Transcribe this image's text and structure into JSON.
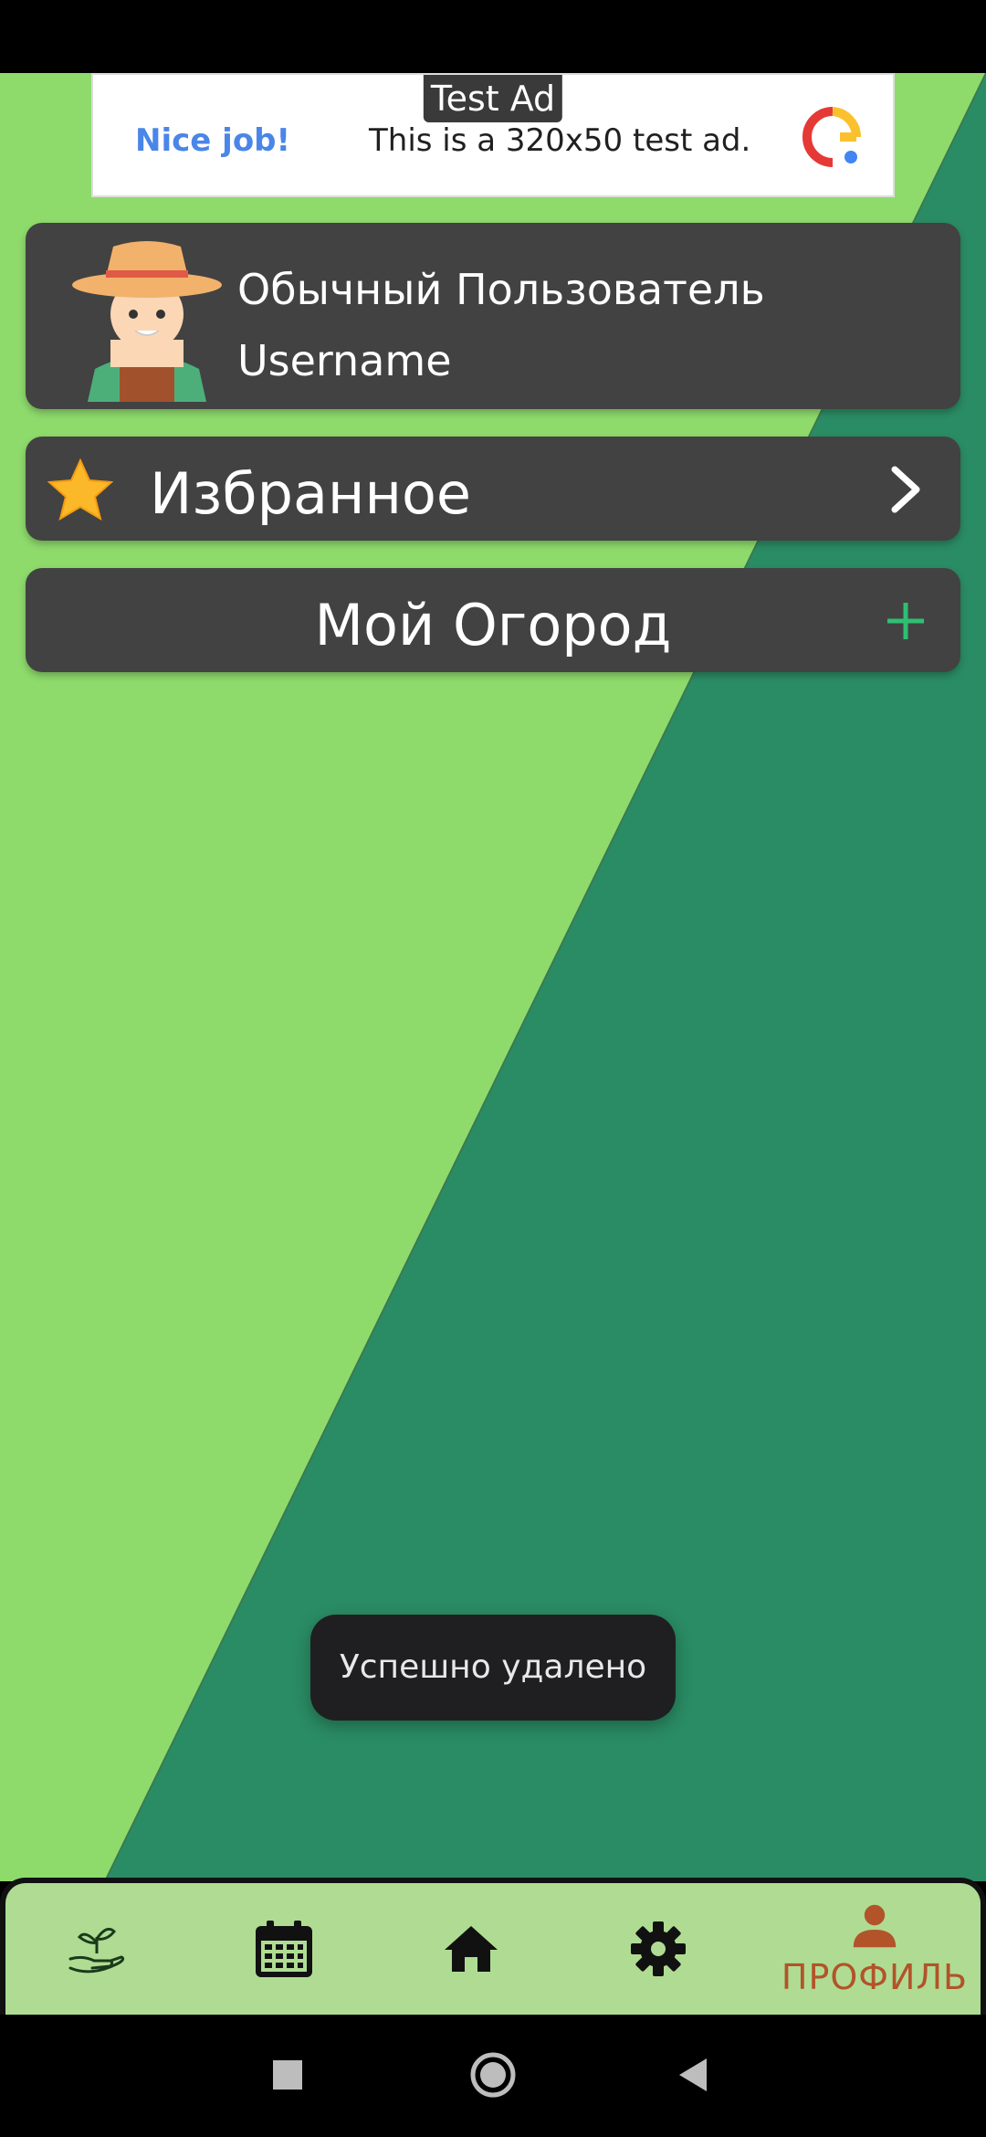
{
  "ad": {
    "label": "Test Ad",
    "headline": "Nice job!",
    "text": "This is a 320x50 test ad."
  },
  "profile": {
    "name": "Обычный Пользователь",
    "username": "Username"
  },
  "favorites": {
    "label": "Избранное"
  },
  "garden": {
    "label": "Мой Огород"
  },
  "toast": {
    "text": "Успешно удалено"
  },
  "bottom_nav": {
    "items": [
      {
        "icon": "plant-hand-icon"
      },
      {
        "icon": "calendar-icon"
      },
      {
        "icon": "home-icon"
      },
      {
        "icon": "gear-icon"
      },
      {
        "icon": "person-icon",
        "label": "ПРОФИЛЬ",
        "active": true
      }
    ]
  },
  "colors": {
    "light_green": "#8edb6c",
    "dark_green": "#2a8c64",
    "card": "#424242",
    "nav_bg": "#afdc92",
    "active": "#b2532a",
    "plus": "#2fbf71"
  }
}
